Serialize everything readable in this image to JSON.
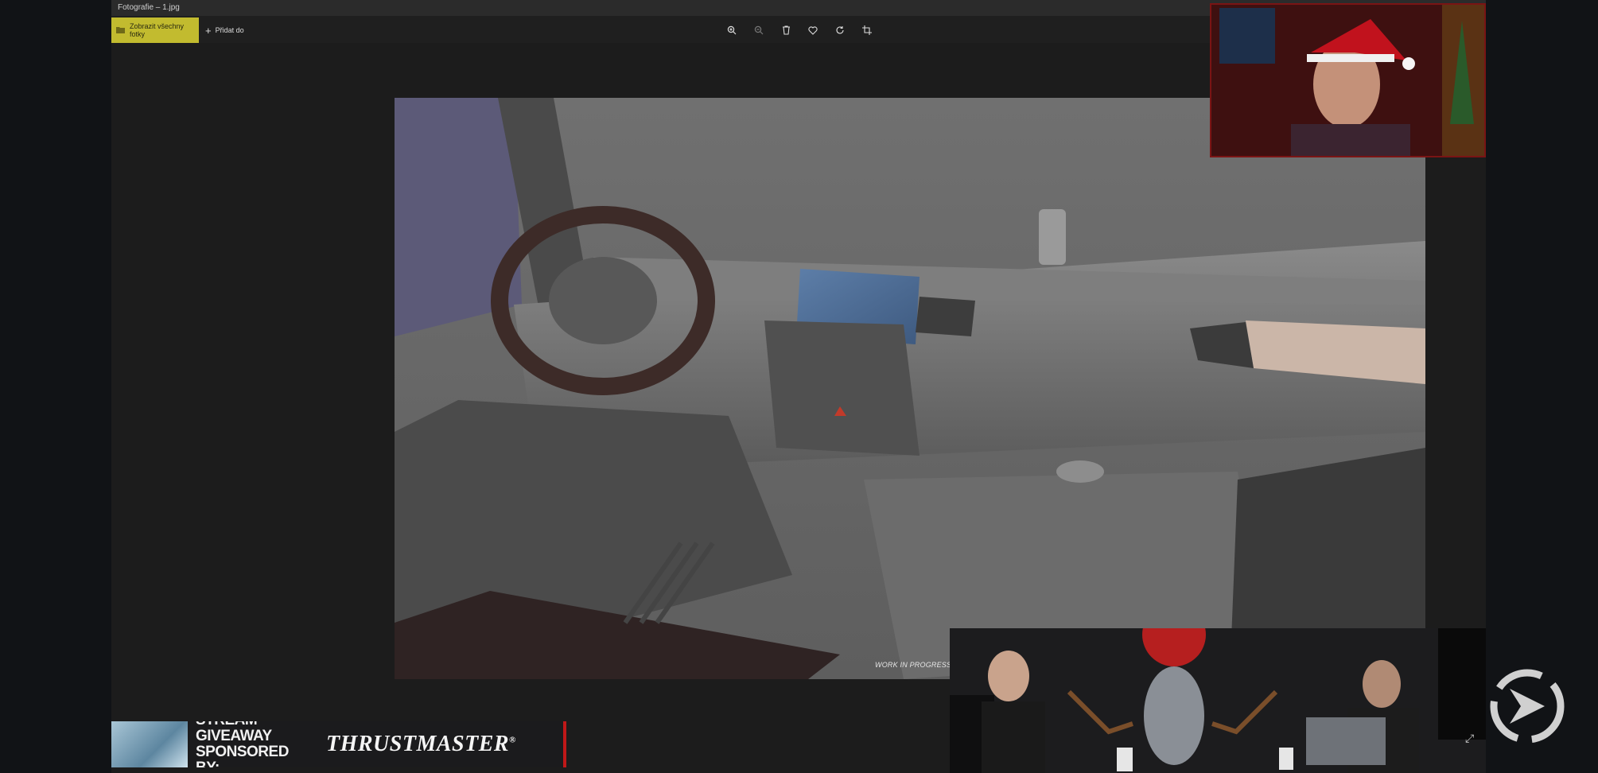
{
  "window": {
    "title": "Fotografie – 1.jpg"
  },
  "toolbar": {
    "view_all_label": "Zobrazit všechny fotky",
    "add_to_label": "Přidat do",
    "icons": [
      "zoom-in-icon",
      "zoom-out-icon",
      "delete-icon",
      "heart-icon",
      "rotate-icon",
      "crop-icon"
    ]
  },
  "photo": {
    "caption": "WORK IN PROGRESS"
  },
  "overlay": {
    "giveaway_text": "STREAM GIVEAWAY SPONSORED BY:",
    "brand_name": "THRUSTMASTER",
    "brand_mark": "®"
  },
  "colors": {
    "accent_button": "#c2bb2f",
    "webcam_border": "#7a1414",
    "banner_accent": "#c01818"
  }
}
